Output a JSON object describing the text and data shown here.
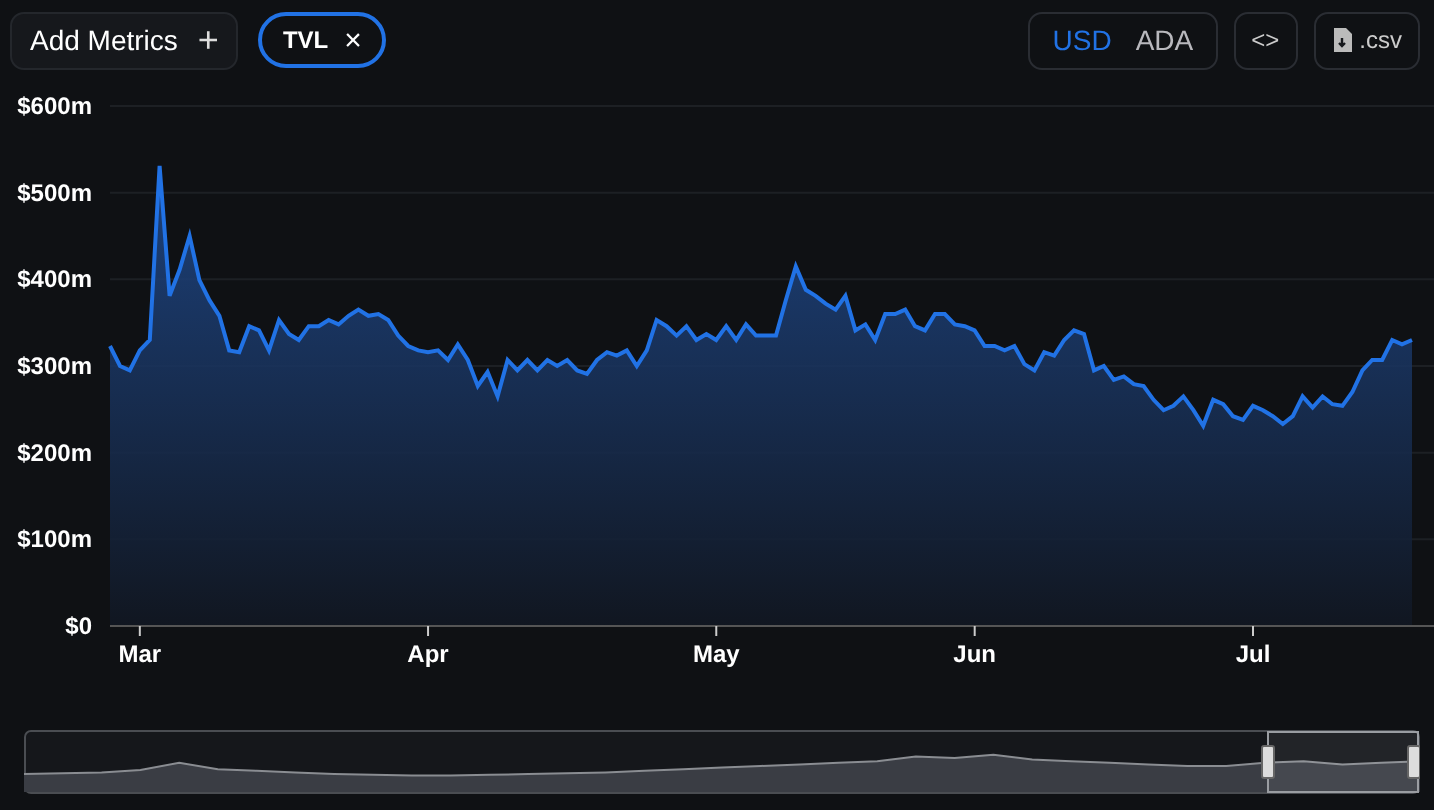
{
  "toolbar": {
    "add_button": {
      "label": "Add Metrics",
      "icon": "+"
    },
    "metric_chips": [
      {
        "label": "TVL",
        "icon": "×"
      }
    ],
    "currencies": [
      {
        "label": "USD",
        "selected": true
      },
      {
        "label": "ADA",
        "selected": false
      }
    ],
    "embed_button": {
      "label": "<>"
    },
    "csv_button": {
      "label": ".csv"
    }
  },
  "chart": {
    "chart_data": {
      "type": "area",
      "categories": [
        null,
        null,
        null,
        "Mar",
        null,
        null,
        null,
        null,
        null,
        null,
        null,
        null,
        null,
        null,
        null,
        null,
        null,
        null,
        null,
        null,
        null,
        null,
        null,
        null,
        null,
        null,
        null,
        null,
        null,
        null,
        null,
        null,
        "Apr",
        null,
        null,
        null,
        null,
        null,
        null,
        null,
        null,
        null,
        null,
        null,
        null,
        null,
        null,
        null,
        null,
        null,
        null,
        null,
        null,
        null,
        null,
        null,
        null,
        null,
        null,
        null,
        null,
        "May",
        null,
        null,
        null,
        null,
        null,
        null,
        null,
        null,
        null,
        null,
        null,
        null,
        null,
        null,
        null,
        null,
        null,
        null,
        null,
        null,
        null,
        null,
        null,
        null,
        null,
        "Jun",
        null,
        null,
        null,
        null,
        null,
        null,
        null,
        null,
        null,
        null,
        null,
        null,
        null,
        null,
        null,
        null,
        null,
        null,
        null,
        null,
        null,
        null,
        null,
        null,
        null,
        null,
        null,
        "Jul",
        null,
        null,
        null,
        null,
        null,
        null,
        null,
        null,
        null,
        null,
        null,
        null,
        null,
        null,
        null,
        null
      ],
      "series": [
        {
          "color": "#2172e5",
          "values": [
            323,
            300,
            295,
            318,
            330,
            531,
            381,
            411,
            450,
            399,
            376,
            358,
            318,
            316,
            346,
            341,
            318,
            353,
            337,
            330,
            346,
            346,
            353,
            348,
            358,
            365,
            358,
            360,
            353,
            335,
            323,
            318,
            316,
            318,
            307,
            325,
            307,
            277,
            293,
            265,
            307,
            295,
            307,
            295,
            307,
            300,
            307,
            295,
            291,
            307,
            316,
            312,
            318,
            300,
            318,
            353,
            346,
            335,
            346,
            330,
            337,
            330,
            346,
            330,
            348,
            335,
            335,
            335,
            376,
            415,
            388,
            381,
            372,
            365,
            381,
            341,
            348,
            330,
            360,
            360,
            365,
            346,
            341,
            360,
            360,
            348,
            346,
            341,
            323,
            323,
            318,
            323,
            302,
            295,
            316,
            312,
            330,
            341,
            337,
            295,
            300,
            284,
            288,
            279,
            277,
            261,
            249,
            254,
            265,
            249,
            231,
            261,
            256,
            242,
            238,
            254,
            249,
            242,
            233,
            242,
            265,
            252,
            265,
            256,
            254,
            270,
            295,
            307,
            307,
            330,
            325,
            330
          ]
        }
      ],
      "ylim": [
        0,
        600
      ],
      "grid": true,
      "yticks": [
        {
          "value": 0,
          "label": "$0"
        },
        {
          "value": 100,
          "label": "$100m"
        },
        {
          "value": 200,
          "label": "$200m"
        },
        {
          "value": 300,
          "label": "$300m"
        },
        {
          "value": 400,
          "label": "$400m"
        },
        {
          "value": 500,
          "label": "$500m"
        },
        {
          "value": 600,
          "label": "$600m"
        }
      ]
    }
  },
  "range_selector": {
    "kind": "brush"
  }
}
